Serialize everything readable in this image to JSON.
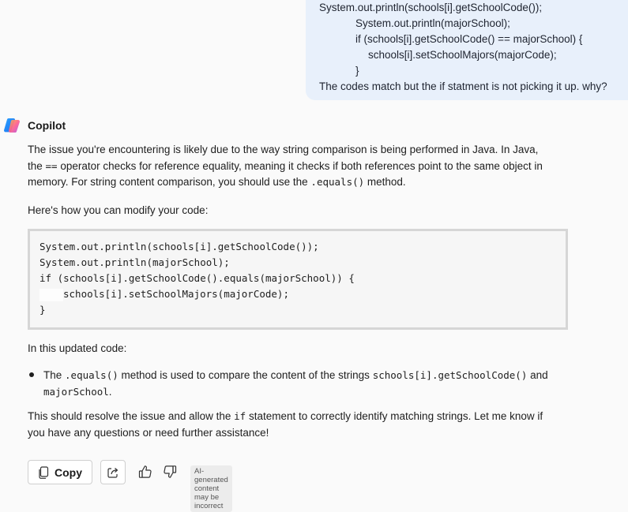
{
  "user_message": {
    "lines": [
      "System.out.println(schools[i].getSchoolCode());",
      "System.out.println(majorSchool);",
      "if (schools[i].getSchoolCode() == majorSchool) {",
      "schools[i].setSchoolMajors(majorCode);",
      "}",
      "The codes match but the if statment is not picking it up. why?"
    ]
  },
  "assistant": {
    "name": "Copilot",
    "intro": {
      "l1": "The issue you're encountering is likely due to the way string comparison is being performed in Java. In Java,",
      "l2_a": "the ",
      "l2_code": "==",
      "l2_b": " operator checks for reference equality, meaning it checks if both references point to the same object in",
      "l3_a": "memory. For string content comparison, you should use the ",
      "l3_code": ".equals()",
      "l3_b": " method."
    },
    "modify_text": "Here's how you can modify your code:",
    "code_lines": [
      "System.out.println(schools[i].getSchoolCode());",
      "System.out.println(majorSchool);",
      "if (schools[i].getSchoolCode().equals(majorSchool)) {",
      "schools[i].setSchoolMajors(majorCode);",
      "}"
    ],
    "updated_text": "In this updated code:",
    "bullet": {
      "a": "The ",
      "code1": ".equals()",
      "b": " method is used to compare the content of the strings ",
      "code2": "schools[i].getSchoolCode()",
      "c": " and",
      "code3": "majorSchool",
      "d": "."
    },
    "conclusion": {
      "l1_a": "This should resolve the issue and allow the ",
      "l1_code": "if",
      "l1_b": " statement to correctly identify matching strings. Let me know if",
      "l2": "you have any questions or need further assistance!"
    }
  },
  "actions": {
    "copy_label": "Copy",
    "copy_icon": "copy-icon",
    "share_icon": "share-icon",
    "like_icon": "thumbs-up-icon",
    "dislike_icon": "thumbs-down-icon",
    "disclaimer": "AI-generated content may be incorrect"
  },
  "colors": {
    "user_bubble": "#e8f0fb",
    "code_border": "#d6d6d6",
    "background": "#fafafa"
  }
}
